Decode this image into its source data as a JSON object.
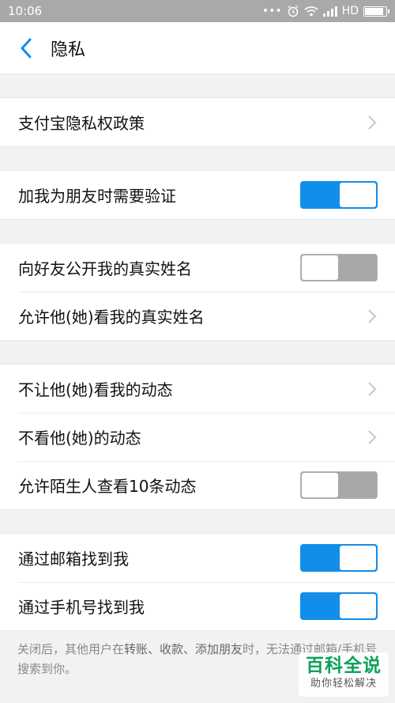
{
  "status_bar": {
    "time": "10:06",
    "network": "HD"
  },
  "header": {
    "title": "隐私"
  },
  "groups": [
    {
      "rows": [
        {
          "label": "支付宝隐私权政策",
          "control": "chevron"
        }
      ]
    },
    {
      "rows": [
        {
          "label": "加我为朋友时需要验证",
          "control": "toggle",
          "on": true
        }
      ]
    },
    {
      "rows": [
        {
          "label": "向好友公开我的真实姓名",
          "control": "toggle",
          "on": false
        },
        {
          "label": "允许他(她)看我的真实姓名",
          "control": "chevron"
        }
      ]
    },
    {
      "rows": [
        {
          "label": "不让他(她)看我的动态",
          "control": "chevron"
        },
        {
          "label": "不看他(她)的动态",
          "control": "chevron"
        },
        {
          "label": "允许陌生人查看10条动态",
          "control": "toggle",
          "on": false
        }
      ]
    },
    {
      "rows": [
        {
          "label": "通过邮箱找到我",
          "control": "toggle",
          "on": true
        },
        {
          "label": "通过手机号找到我",
          "control": "toggle",
          "on": true
        }
      ]
    }
  ],
  "footnote": {
    "prefix": "关闭后，其他用户在",
    "highlight": "转账、收款、添加朋友",
    "suffix": "时，无法通过邮箱/手机号搜索到你。"
  },
  "watermark": {
    "main": "百科全说",
    "sub": "助你轻松解决"
  },
  "colors": {
    "accent": "#108ee9",
    "toggle_off": "#a7a8a7",
    "statusbar": "#a9a9a9",
    "watermark": "#0aa35a"
  },
  "icons": {
    "back": "chevron-left-icon",
    "row_arrow": "chevron-right-icon",
    "wifi": "wifi-icon",
    "signal": "signal-icon",
    "alarm": "alarm-icon",
    "battery": "battery-icon"
  },
  "battery_level": 0.9
}
